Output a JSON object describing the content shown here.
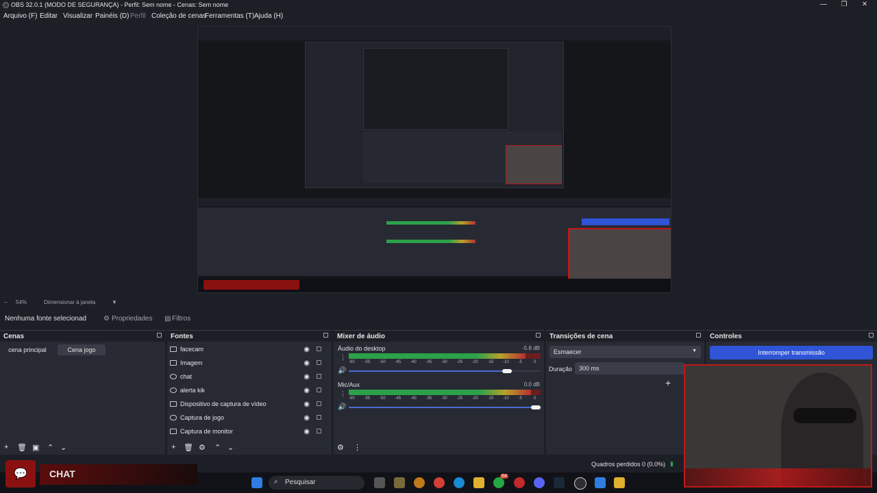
{
  "window": {
    "title": "OBS 32.0.1 (MODO DE SEGURANÇA) - Perfil: Sem nome - Cenas: Sem nome",
    "minimize_icon": "minimize-icon",
    "maximize_icon": "maximize-icon",
    "close_icon": "close-icon"
  },
  "menu": {
    "items": [
      "Arquivo (F)",
      "Editar",
      "Visualizar",
      "Painéis (D)",
      "Perfil",
      "Coleção de cenas",
      "Ferramentas (T)",
      "Ajuda (H)"
    ]
  },
  "zoombar": {
    "minus": "−",
    "zoom": "54%",
    "resize": "Dimensionar à janela"
  },
  "sourcebar": {
    "no_source": "Nenhuma fonte selecionad",
    "properties": "Propriedades",
    "filters": "Filtros"
  },
  "scenes": {
    "title": "Cenas",
    "items": [
      "cena principal",
      "Cena jogo"
    ]
  },
  "sources": {
    "title": "Fontes",
    "items": [
      "facecam",
      "Imagem",
      "chat",
      "alerta kik",
      "Dispositivo de captura de vídeo",
      "Captura de jogo",
      "Captura de monitor"
    ]
  },
  "mixer": {
    "title": "Mixer de áudio",
    "channels": [
      {
        "name": "Áudio do desktop",
        "db": "-5.8 dB",
        "level": 0.92,
        "volume": 0.85
      },
      {
        "name": "Mic/Aux",
        "db": "0.0 dB",
        "level": 0.95,
        "volume": 1.0
      }
    ],
    "ticks": [
      "-60",
      "-55",
      "-50",
      "-45",
      "-40",
      "-35",
      "-30",
      "-25",
      "-20",
      "-15",
      "-10",
      "-5",
      "0"
    ]
  },
  "transitions": {
    "title": "Transições de cena",
    "selected": "Esmaecer",
    "duration_label": "Duração",
    "duration_value": "300 ms"
  },
  "controls": {
    "title": "Controles",
    "stop_stream": "Interromper transmissão"
  },
  "status": {
    "dropped_frames": "Quadros perdidos 0 (0.0%)"
  },
  "taskbar": {
    "search_placeholder": "Pesquisar",
    "badge": "64"
  },
  "overlay": {
    "chat_label": "CHAT"
  },
  "colors": {
    "accent_blue": "#2f54d6",
    "meter_green": "#2da14a",
    "meter_yellow": "#b8a12a",
    "meter_red": "#b33030",
    "overlay_red": "#c01818"
  }
}
